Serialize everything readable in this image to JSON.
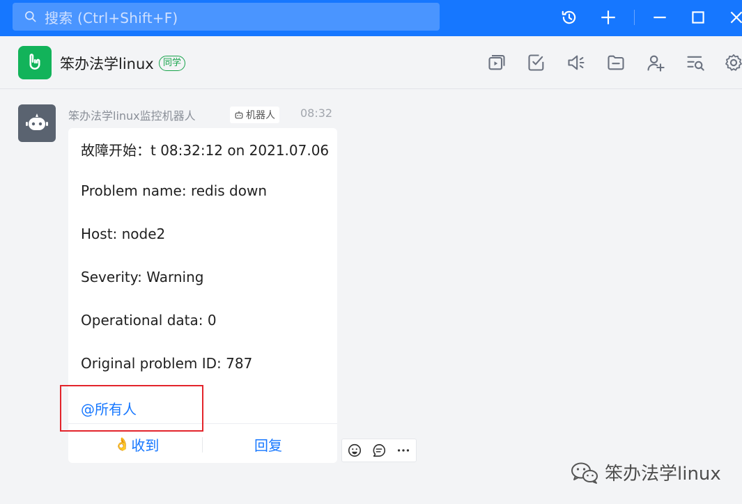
{
  "topbar": {
    "search_placeholder": "搜索 (Ctrl+Shift+F)",
    "accent": "#1677ff",
    "icons": [
      "history-icon",
      "add-icon",
      "minimize-icon",
      "maximize-icon",
      "close-icon"
    ]
  },
  "header": {
    "group_name": "笨办法学linux",
    "group_badge": "同学",
    "icons": [
      "video-meeting-icon",
      "task-check-icon",
      "announcement-icon",
      "folder-icon",
      "add-member-icon",
      "search-history-icon",
      "settings-icon"
    ]
  },
  "message": {
    "sender": "笨办法学linux监控机器人",
    "bot_tag": "机器人",
    "time": "08:32",
    "lines": [
      "故障开始：t 08:32:12 on 2021.07.06",
      "Problem name: redis down",
      "Host: node2",
      "Severity: Warning",
      "Operational data: 0",
      "Original problem ID: 787"
    ],
    "mention": "@所有人",
    "actions": {
      "received": "收到",
      "reply": "回复"
    },
    "highlight_color": "#e3242b"
  },
  "reactions": [
    "emoji-icon",
    "comment-icon",
    "more-icon"
  ],
  "watermark": {
    "text": "笨办法学linux",
    "icon": "wechat-icon"
  }
}
